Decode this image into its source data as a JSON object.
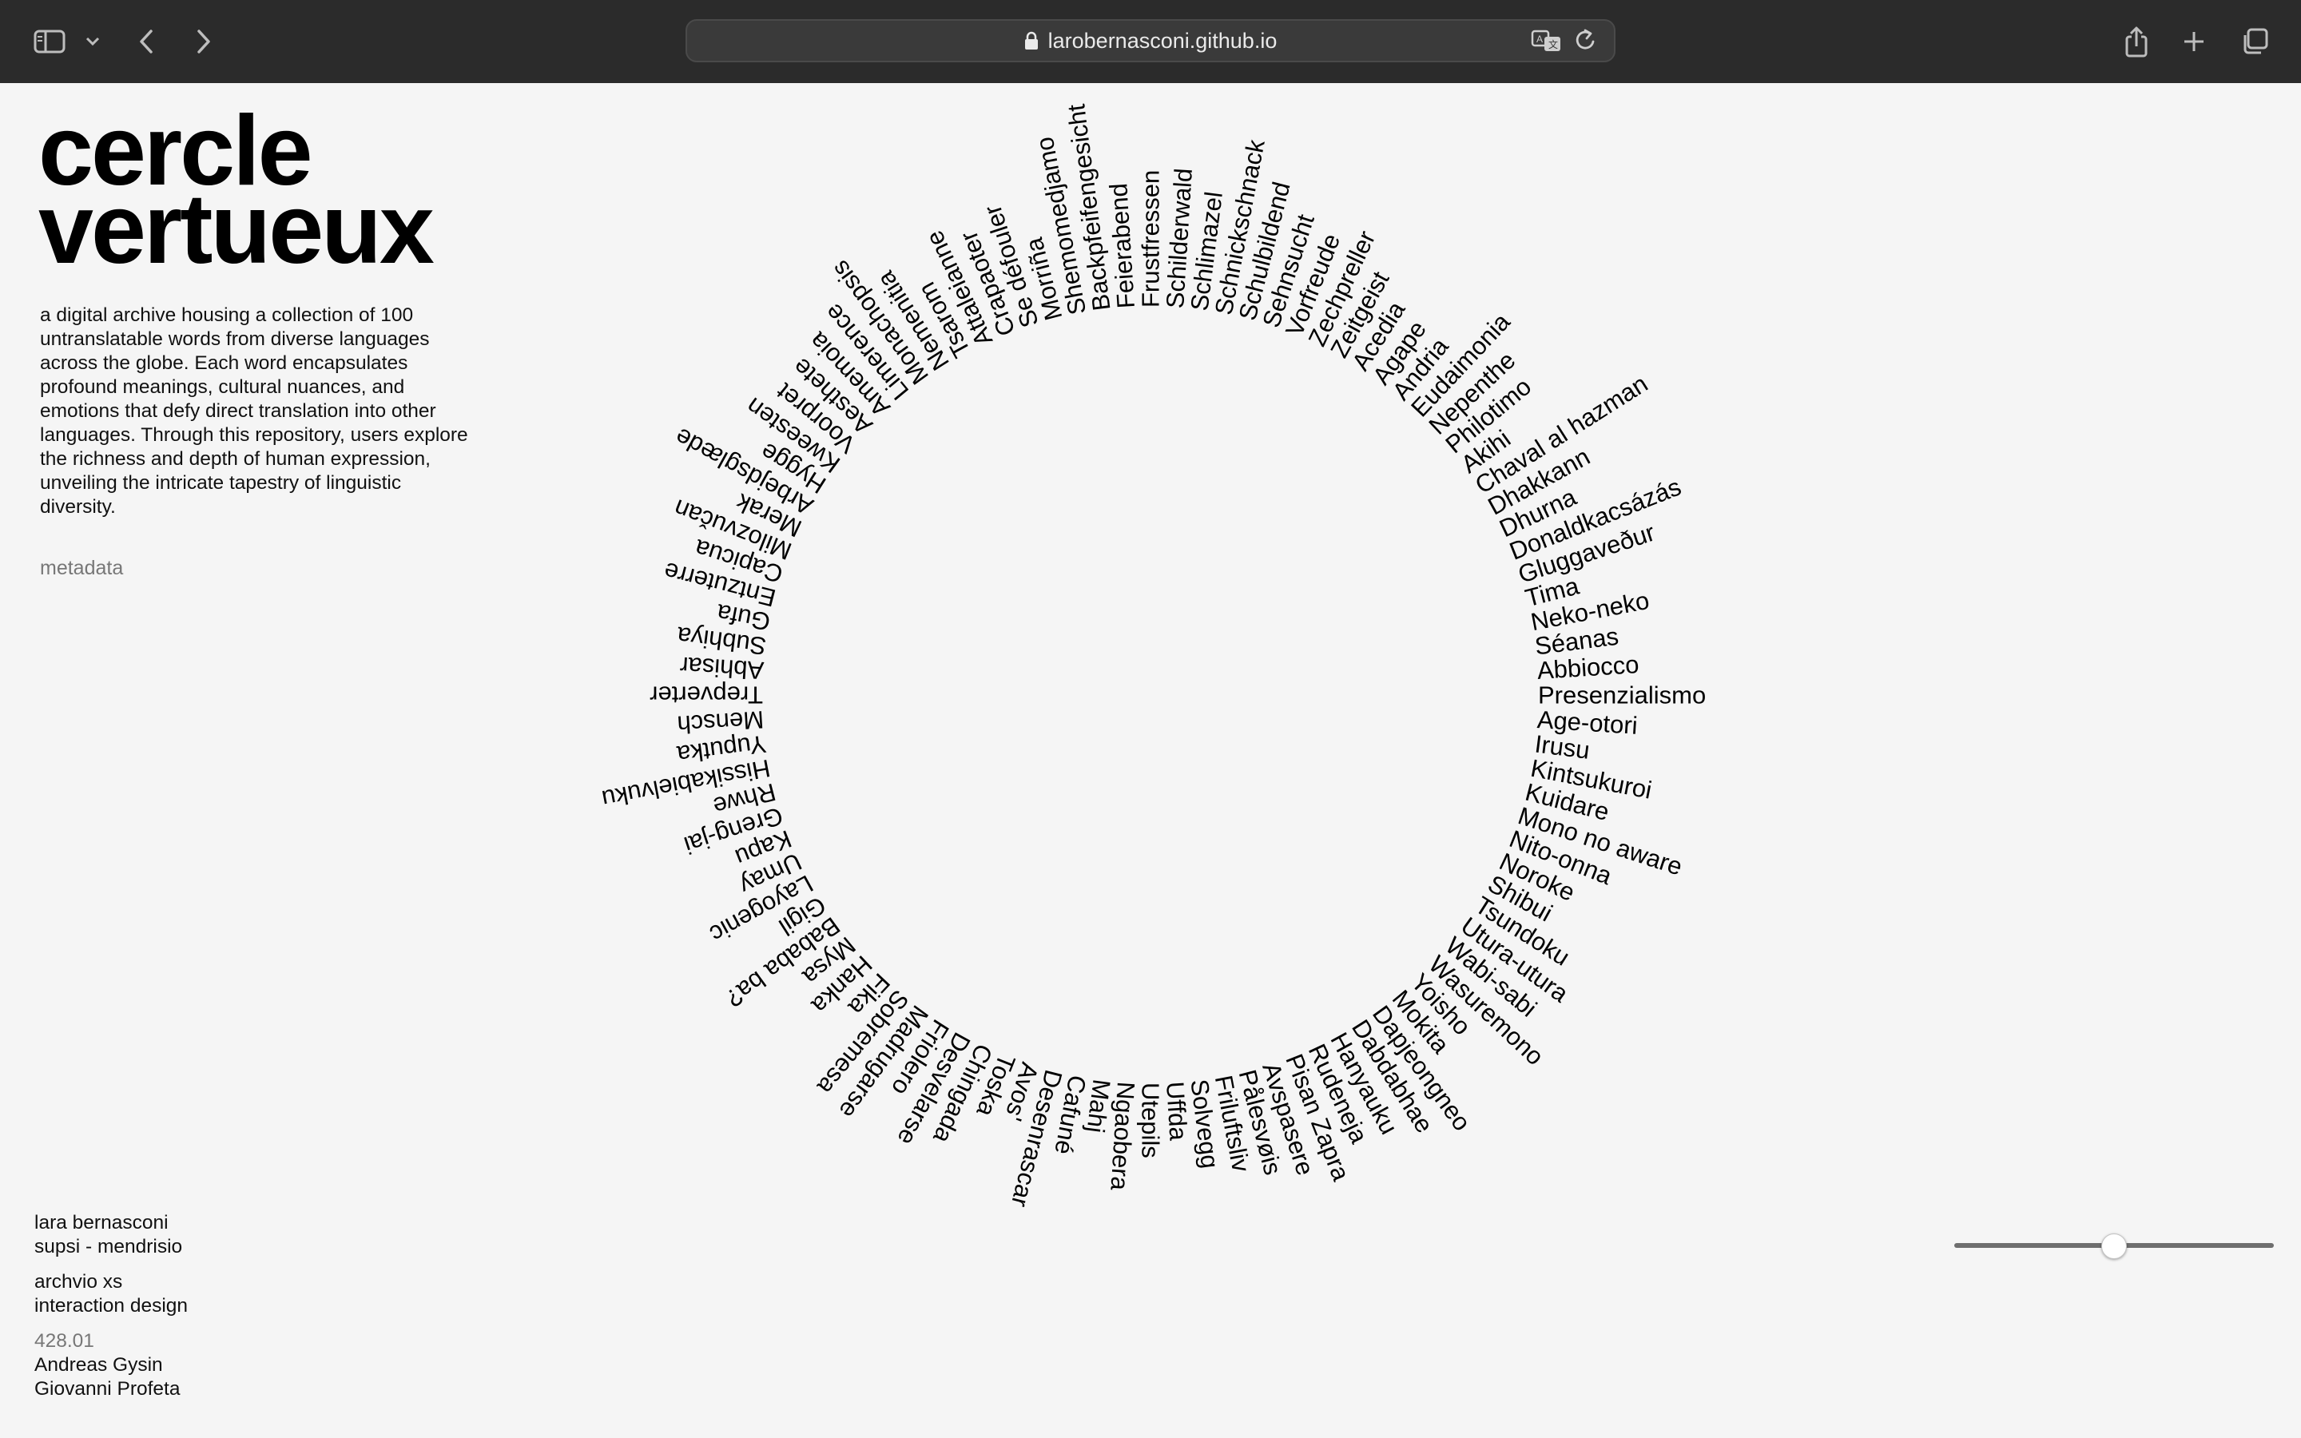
{
  "browser": {
    "url": "larobernasconi.github.io",
    "icons": [
      "sidebar-icon",
      "chevron-down-icon",
      "back-icon",
      "forward-icon",
      "lock-icon",
      "translate-icon",
      "reload-icon",
      "share-icon",
      "new-tab-icon",
      "tab-overview-icon"
    ]
  },
  "sidebar": {
    "title_line1": "cercle",
    "title_line2": "vertueux",
    "description": "a digital archive housing a collection of 100 untranslatable words from diverse languages across the globe. Each word encapsulates profound meanings, cultural nuances, and emotions that defy direct translation into other languages. Through this repository, users explore the richness and depth of human expression, unveiling the intricate tapestry of linguistic diversity.",
    "metadata_link": "metadata"
  },
  "credits": {
    "author": "lara bernasconi",
    "school": "supsi - mendrisio",
    "course": "archvio xs",
    "program": "interaction design",
    "code": "428.01",
    "teacher1": "Andreas Gysin",
    "teacher2": "Giovanni Profeta"
  },
  "words": [
    "Presenzialismo",
    "Age-otori",
    "Irusu",
    "Kintsukuroi",
    "Kuidare",
    "Mono no aware",
    "Nito-onna",
    "Noroke",
    "Shibui",
    "Tsundoku",
    "Utura-utura",
    "Wabi-sabi",
    "Wasuremono",
    "Yoisho",
    "Mokita",
    "Dapjeongneo",
    "Dabdabhae",
    "Hanyauku",
    "Rudeneja",
    "Pisan Zapra",
    "Avspasere",
    "Pålesvøis",
    "Friluftsliv",
    "Solvegg",
    "Uffda",
    "Utepils",
    "Ngaobera",
    "Mahj",
    "Cafuné",
    "Desenrascar",
    "Avos'",
    "Toska",
    "Chingada",
    "Desvelarse",
    "Friolero",
    "Madrugarse",
    "Sobremesa",
    "Fika",
    "Hanka",
    "Mysa",
    "Bababa ba?",
    "Gigil",
    "Layogenic",
    "Umay",
    "Kapu",
    "Greng-jai",
    "Rhwe",
    "Hissikabielvuku",
    "Yuputka",
    "Mensch",
    "Trepverter",
    "Abhisar",
    "Subhiya",
    "Gufa",
    "Entzuterre",
    "Capicua",
    "Milozvučan",
    "Merak",
    "Arbejdsglæde",
    "Hygge",
    "Kweesten",
    "Voorpret",
    "Aesthete",
    "Amemoia",
    "Limerence",
    "Monachopsis",
    "Nemenitia",
    "Tsarom",
    "Attaleianne",
    "Crapaoter",
    "Se défouler",
    "Morriña",
    "Shemomedjamo",
    "Backpfeifengesicht",
    "Feierabend",
    "Frustfressen",
    "Schilderwald",
    "Schlimazel",
    "Schnickschnack",
    "Schulbildend",
    "Sehnsucht",
    "Vorfreude",
    "Zechpreller",
    "Zeitgeist",
    "Acedia",
    "Agape",
    "Andria",
    "Eudaimonia",
    "Nepenthe",
    "Philotimo",
    "Akihi",
    "Chaval al hazman",
    "Dhakkann",
    "Dhurna",
    "Donaldkacsázás",
    "Gluggaveður",
    "Tima",
    "Neko-neko",
    "Séanas",
    "Abbiocco"
  ],
  "slider": {
    "value_fraction": 0.5
  }
}
